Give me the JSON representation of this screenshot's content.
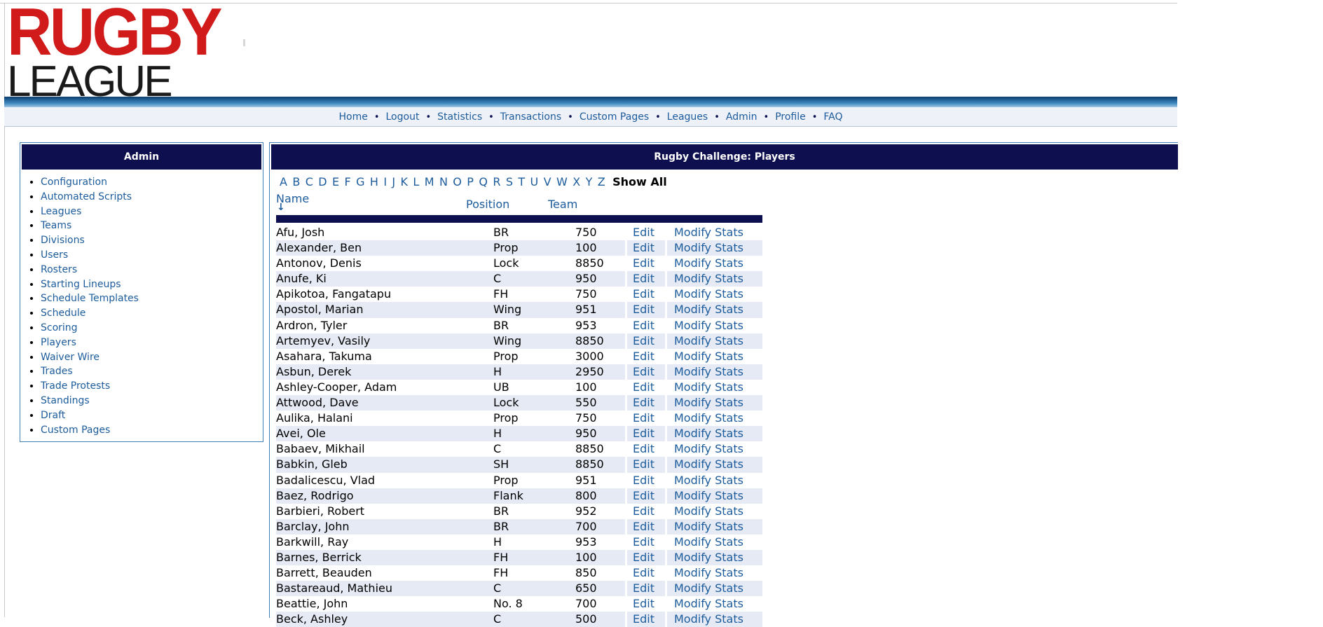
{
  "logo": {
    "line1": "RUGBY",
    "line2": "LEAGUE"
  },
  "nav": [
    "Home",
    "Logout",
    "Statistics",
    "Transactions",
    "Custom Pages",
    "Leagues",
    "Admin",
    "Profile",
    "FAQ"
  ],
  "nav_separator": "•",
  "sidebar": {
    "title": "Admin",
    "items": [
      "Configuration",
      "Automated Scripts",
      "Leagues",
      "Teams",
      "Divisions",
      "Users",
      "Rosters",
      "Starting Lineups",
      "Schedule Templates",
      "Schedule",
      "Scoring",
      "Players",
      "Waiver Wire",
      "Trades",
      "Trade Protests",
      "Standings",
      "Draft",
      "Custom Pages"
    ]
  },
  "main": {
    "title": "Rugby Challenge: Players",
    "letters": [
      "A",
      "B",
      "C",
      "D",
      "E",
      "F",
      "G",
      "H",
      "I",
      "J",
      "K",
      "L",
      "M",
      "N",
      "O",
      "P",
      "Q",
      "R",
      "S",
      "T",
      "U",
      "V",
      "W",
      "X",
      "Y",
      "Z"
    ],
    "show_all": "Show All",
    "columns": {
      "name": "Name",
      "position": "Position",
      "team": "Team"
    },
    "sort_icon": "↓",
    "edit_label": "Edit",
    "modify_label": "Modify Stats",
    "rows": [
      [
        "Afu, Josh",
        "BR",
        "750"
      ],
      [
        "Alexander, Ben",
        "Prop",
        "100"
      ],
      [
        "Antonov, Denis",
        "Lock",
        "8850"
      ],
      [
        "Anufe, Ki",
        "C",
        "950"
      ],
      [
        "Apikotoa, Fangatapu",
        "FH",
        "750"
      ],
      [
        "Apostol, Marian",
        "Wing",
        "951"
      ],
      [
        "Ardron, Tyler",
        "BR",
        "953"
      ],
      [
        "Artemyev, Vasily",
        "Wing",
        "8850"
      ],
      [
        "Asahara, Takuma",
        "Prop",
        "3000"
      ],
      [
        "Asbun, Derek",
        "H",
        "2950"
      ],
      [
        "Ashley-Cooper, Adam",
        "UB",
        "100"
      ],
      [
        "Attwood, Dave",
        "Lock",
        "550"
      ],
      [
        "Aulika, Halani",
        "Prop",
        "750"
      ],
      [
        "Avei, Ole",
        "H",
        "950"
      ],
      [
        "Babaev, Mikhail",
        "C",
        "8850"
      ],
      [
        "Babkin, Gleb",
        "SH",
        "8850"
      ],
      [
        "Badalicescu, Vlad",
        "Prop",
        "951"
      ],
      [
        "Baez, Rodrigo",
        "Flank",
        "800"
      ],
      [
        "Barbieri, Robert",
        "BR",
        "952"
      ],
      [
        "Barclay, John",
        "BR",
        "700"
      ],
      [
        "Barkwill, Ray",
        "H",
        "953"
      ],
      [
        "Barnes, Berrick",
        "FH",
        "100"
      ],
      [
        "Barrett, Beauden",
        "FH",
        "850"
      ],
      [
        "Bastareaud, Mathieu",
        "C",
        "650"
      ],
      [
        "Beattie, John",
        "No. 8",
        "700"
      ],
      [
        "Beck, Ashley",
        "C",
        "500"
      ]
    ]
  }
}
